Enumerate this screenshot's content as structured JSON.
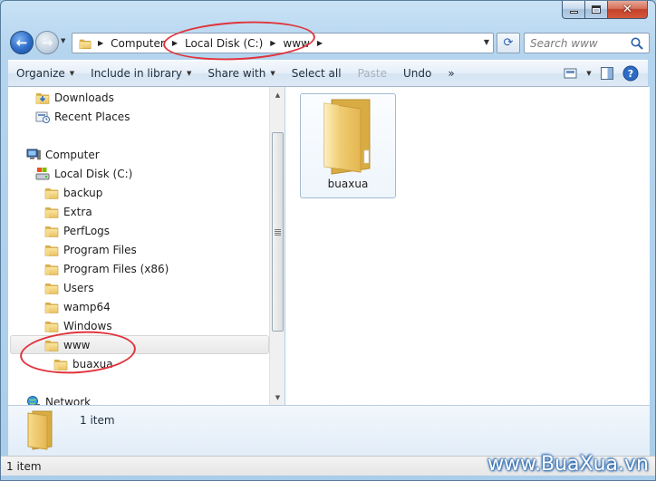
{
  "window": {
    "caption_buttons": [
      "minimize",
      "maximize",
      "close"
    ]
  },
  "address_bar": {
    "crumbs": [
      "Computer",
      "Local Disk (C:)",
      "www"
    ],
    "search_placeholder": "Search www"
  },
  "toolbar": {
    "organize": "Organize",
    "include_in_library": "Include in library",
    "share_with": "Share with",
    "select_all": "Select all",
    "paste": "Paste",
    "undo": "Undo",
    "more": "»"
  },
  "navigation": {
    "favorites": [
      {
        "label": "Downloads",
        "icon": "downloads-folder-icon"
      },
      {
        "label": "Recent Places",
        "icon": "recent-places-icon"
      }
    ],
    "computer": {
      "label": "Computer",
      "icon": "computer-icon"
    },
    "drive": {
      "label": "Local Disk (C:)",
      "icon": "drive-icon"
    },
    "folders": [
      "backup",
      "Extra",
      "PerfLogs",
      "Program Files",
      "Program Files (x86)",
      "Users",
      "wamp64",
      "Windows",
      "www"
    ],
    "selected_folder": "www",
    "subfolder": "buaxua",
    "network": {
      "label": "Network",
      "icon": "network-icon"
    }
  },
  "content": {
    "items": [
      {
        "label": "buaxua",
        "icon": "folder-icon"
      }
    ]
  },
  "details_pane": {
    "item_count": "1 item"
  },
  "status_bar": {
    "text": "1 item"
  },
  "watermark": "www.BuaXua.vn",
  "colors": {
    "highlight_ring": "#e0343d",
    "folder_yellow": "#f2d27a"
  }
}
